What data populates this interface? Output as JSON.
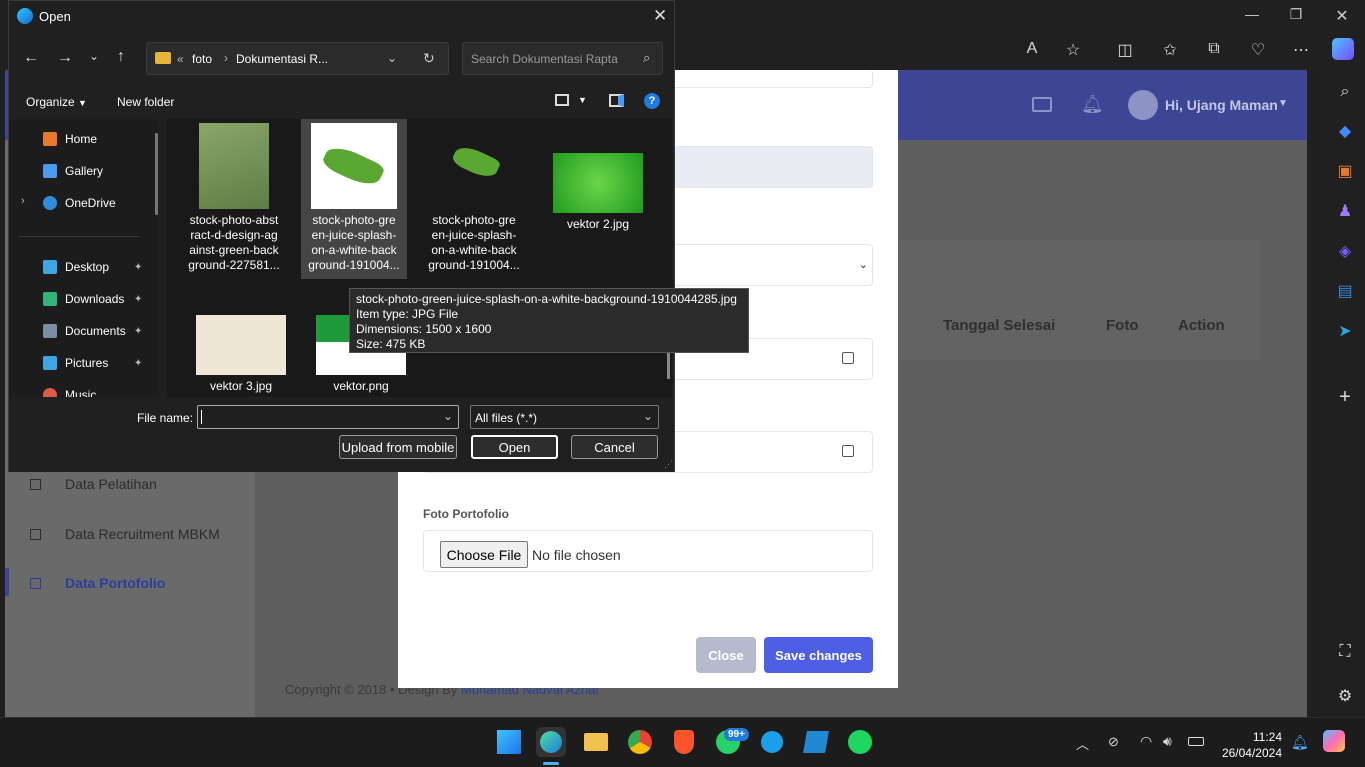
{
  "dialog": {
    "title": "Open",
    "address_path": [
      "foto",
      "Dokumentasi R..."
    ],
    "search_placeholder": "Search Dokumentasi Rapta",
    "organize_label": "Organize",
    "new_folder_label": "New folder",
    "nav_items": [
      {
        "label": "Home"
      },
      {
        "label": "Gallery"
      },
      {
        "label": "OneDrive"
      },
      {
        "label": "Desktop"
      },
      {
        "label": "Downloads"
      },
      {
        "label": "Documents"
      },
      {
        "label": "Pictures"
      },
      {
        "label": "Music"
      }
    ],
    "files": [
      {
        "name": "stock-photo-abst\nract-d-design-ag\nainst-green-back\nground-227581..."
      },
      {
        "name": "stock-photo-gre\nen-juice-splash-\non-a-white-back\nground-191004..."
      },
      {
        "name": "stock-photo-gre\nen-juice-splash-\non-a-white-back\nground-191004..."
      },
      {
        "name": "vektor 2.jpg"
      },
      {
        "name": "vektor 3.jpg"
      },
      {
        "name": "vektor.png"
      }
    ],
    "tooltip": {
      "line1": "stock-photo-green-juice-splash-on-a-white-background-1910044285.jpg",
      "line2": "Item type: JPG File",
      "line3": "Dimensions: 1500 x 1600",
      "line4": "Size: 475 KB"
    },
    "file_name_label": "File name:",
    "file_name_value": "",
    "file_type_value": "All files (*.*)",
    "upload_button": "Upload from mobile",
    "open_button": "Open",
    "cancel_button": "Cancel"
  },
  "page": {
    "user_greeting": "Hi, Ujang Maman",
    "table_headers": [
      "Tanggal Selesai",
      "Foto",
      "Action"
    ],
    "sidebar_items": [
      "Data Pelatihan",
      "Data Recruitment MBKM",
      "Data Portofolio"
    ],
    "footer_text": "Copyright © 2018  •  Design By ",
    "footer_author": "Muhamad Nauval Azhar"
  },
  "modal": {
    "foto_label": "Foto Portofolio",
    "choose_file_label": "Choose File",
    "no_file_text": "No file chosen",
    "close_button": "Close",
    "save_button": "Save changes"
  },
  "taskbar": {
    "whatsapp_badge": "99+",
    "time": "11:24",
    "date": "26/04/2024"
  },
  "colors": {
    "accent": "#3c4694",
    "save": "#4e5fe6"
  }
}
